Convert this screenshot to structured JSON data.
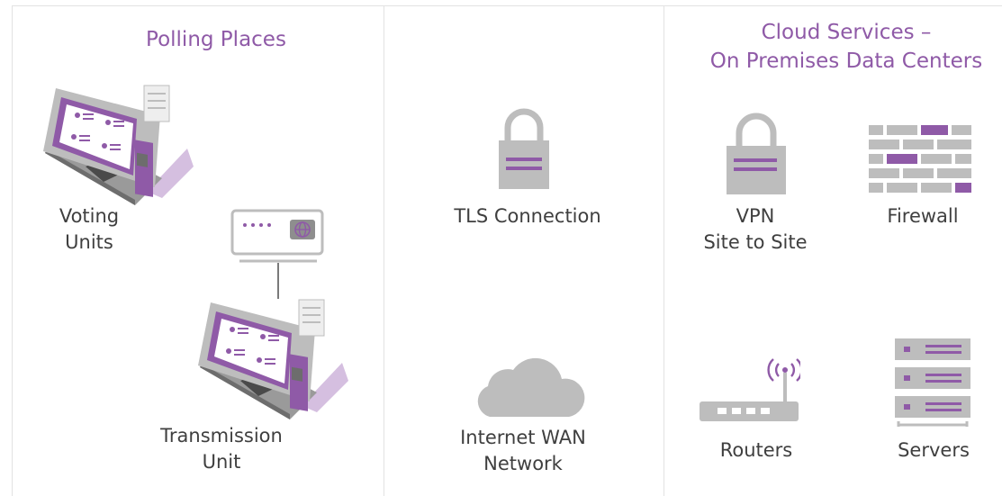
{
  "regions": {
    "polling": {
      "title": "Polling Places"
    },
    "cloud": {
      "title_line1": "Cloud Services –",
      "title_line2": "On Premises Data Centers"
    }
  },
  "labels": {
    "voting_units_line1": "Voting",
    "voting_units_line2": "Units",
    "transmission_line1": "Transmission",
    "transmission_line2": "Unit",
    "tls": "TLS Connection",
    "internet_line1": "Internet WAN",
    "internet_line2": "Network",
    "vpn_line1": "VPN",
    "vpn_line2": "Site to Site",
    "firewall": "Firewall",
    "routers": "Routers",
    "servers": "Servers"
  },
  "colors": {
    "accent_purple": "#8f5aa7",
    "light_purple": "#d5bfe0",
    "icon_gray": "#bdbdbd",
    "dark_gray": "#7a7a7a"
  },
  "icons": [
    "voting-machine-icon",
    "modem-icon",
    "lock-icon",
    "cloud-icon",
    "firewall-icon",
    "router-icon",
    "server-icon"
  ]
}
